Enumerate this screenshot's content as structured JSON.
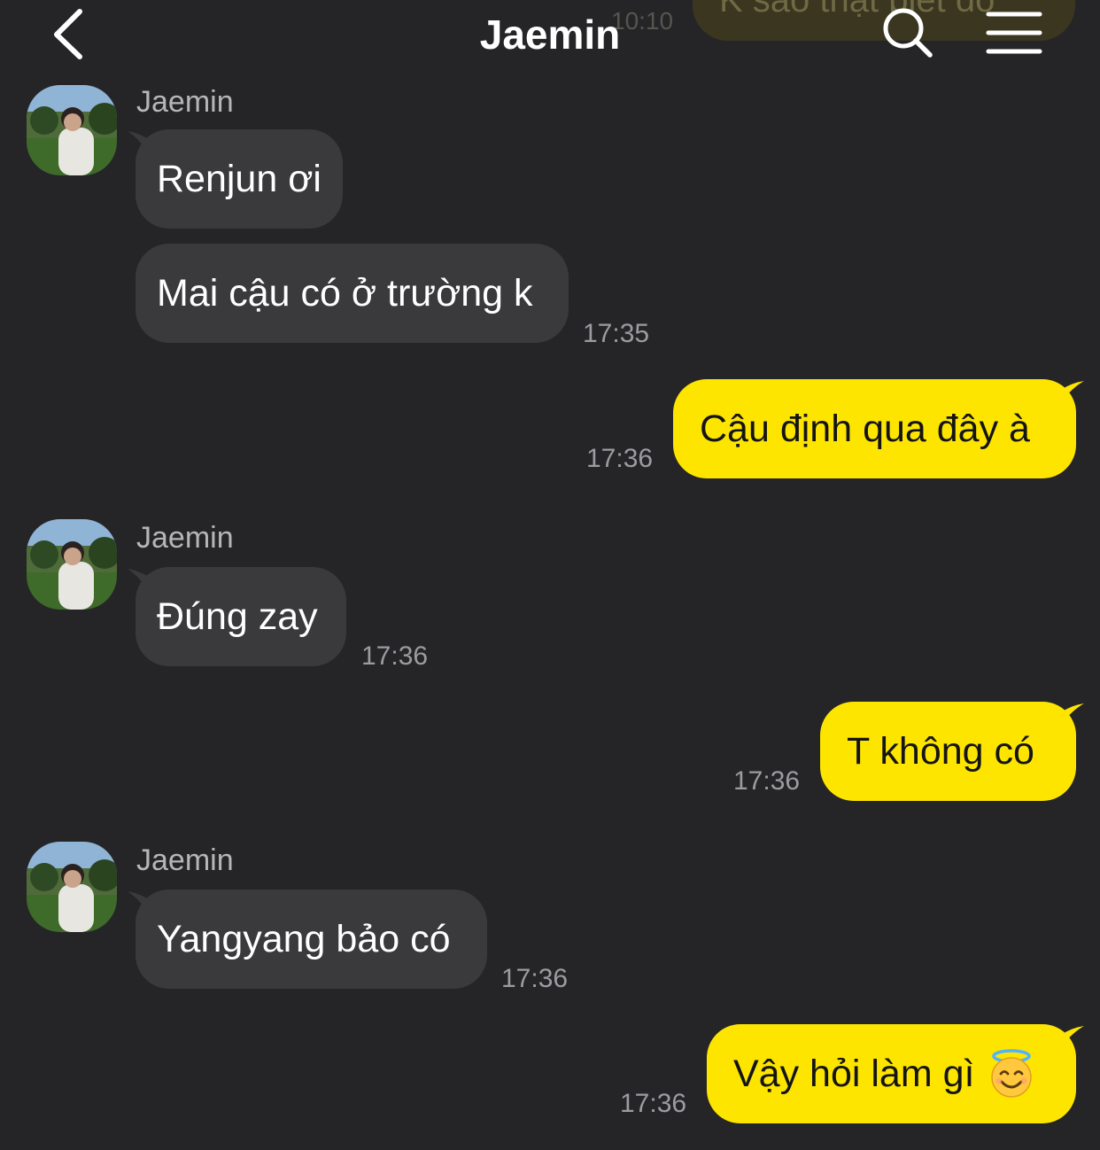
{
  "header": {
    "title": "Jaemin",
    "peek_text": "K sao thật biết đó",
    "peek_time": "10:10",
    "back_icon": "chevron-left-icon",
    "search_icon": "search-icon",
    "menu_icon": "menu-icon"
  },
  "colors": {
    "background": "#252527",
    "incoming_bubble": "#3a3a3d",
    "outgoing_bubble": "#fee500"
  },
  "messages": [
    {
      "direction": "in",
      "sender": "Jaemin",
      "text": "Renjun ơi",
      "time": ""
    },
    {
      "direction": "in",
      "sender": "",
      "text": "Mai cậu có ở trường k",
      "time": "17:35"
    },
    {
      "direction": "out",
      "text": "Cậu định qua đây à",
      "time": "17:36"
    },
    {
      "direction": "in",
      "sender": "Jaemin",
      "text": "Đúng zay",
      "time": "17:36"
    },
    {
      "direction": "out",
      "text": "T không có",
      "time": "17:36"
    },
    {
      "direction": "in",
      "sender": "Jaemin",
      "text": "Yangyang bảo có",
      "time": "17:36"
    },
    {
      "direction": "out",
      "text": "Vậy hỏi làm gì",
      "emoji": "smiling-face-with-halo-icon",
      "time": "17:36"
    }
  ]
}
